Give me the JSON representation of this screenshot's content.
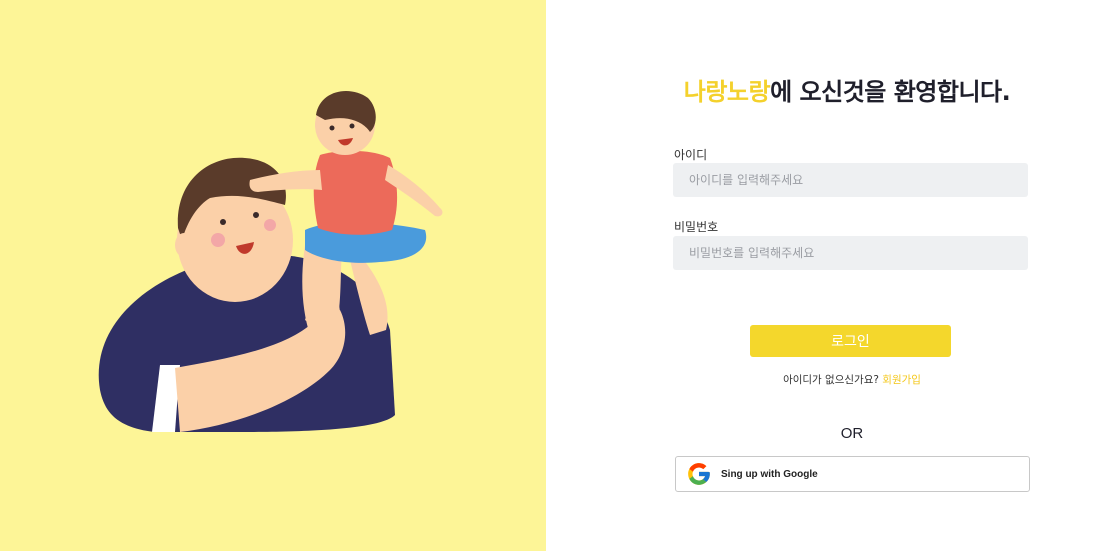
{
  "welcome": {
    "brand": "나랑노랑",
    "rest": "에 오신것을 환영합니다."
  },
  "form": {
    "id_label": "아이디",
    "id_placeholder": "아이디를 입력해주세요",
    "password_label": "비밀번호",
    "password_placeholder": "비밀번호를 입력해주세요",
    "login_label": "로그인"
  },
  "signup": {
    "question": "아이디가 없으신가요?",
    "link_label": "회원가입"
  },
  "divider": {
    "text": "OR"
  },
  "google": {
    "label": "Sing up with Google",
    "icon": "google-icon"
  },
  "colors": {
    "brand": "#f4d12c",
    "left_bg": "#fdf597",
    "button": "#f4d72c",
    "input_bg": "#eef0f2"
  },
  "illustration": {
    "subject": "father-lifting-child-illustration"
  }
}
